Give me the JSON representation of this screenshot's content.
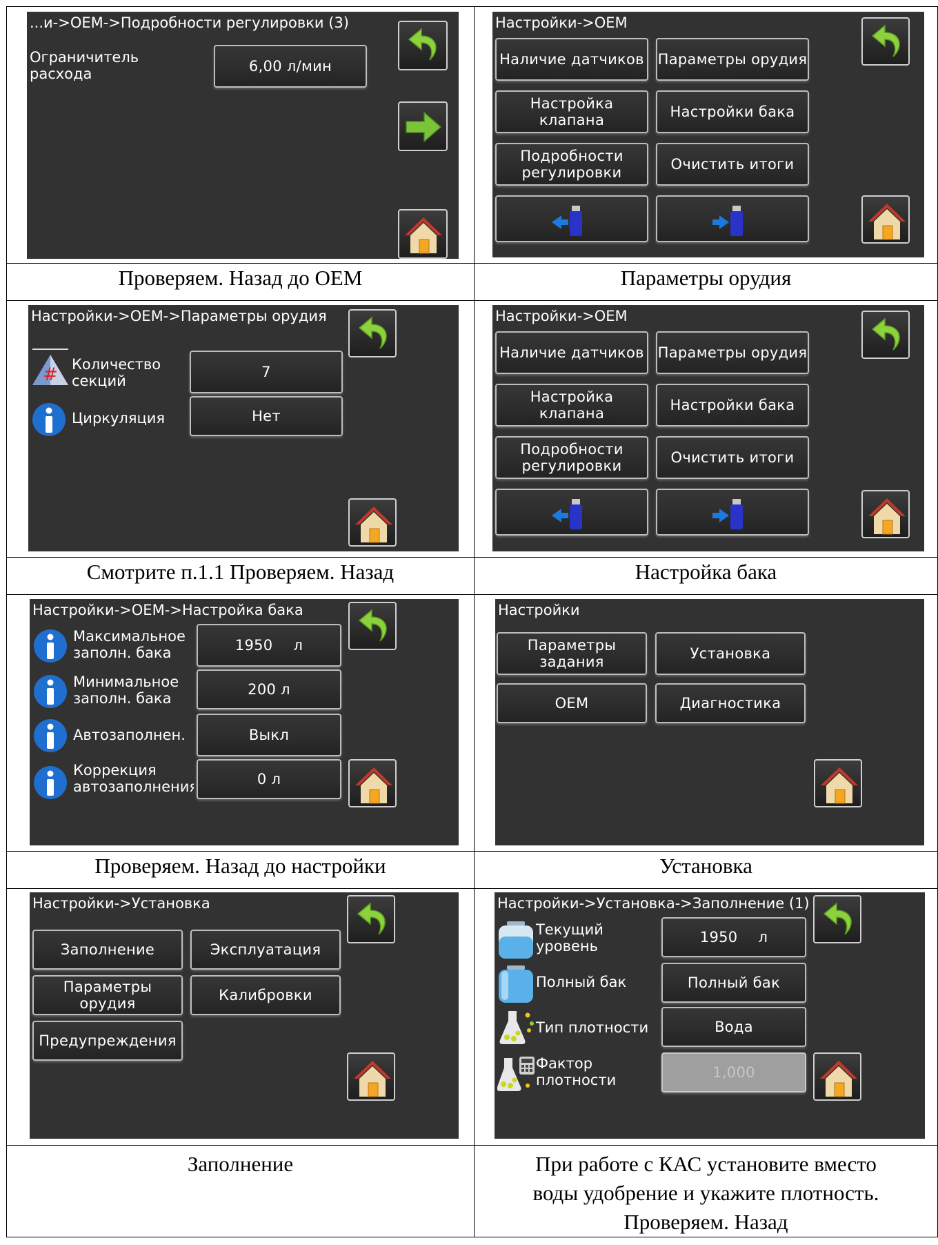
{
  "s1": {
    "title": "...и->OEM->Подробности регулировки (3)",
    "label": "Ограничитель расхода",
    "value": "6,00 л/мин"
  },
  "s2": {
    "title": "Настройки->OEM",
    "buttons": [
      "Наличие датчиков",
      "Параметры орудия",
      "Настройка клапана",
      "Настройки бака",
      "Подробности регулировки",
      "Очистить итоги"
    ]
  },
  "s3": {
    "title": "Настройки->OEM->Параметры орудия",
    "rows": [
      {
        "label": "Количество секций",
        "value": "7"
      },
      {
        "label": "Циркуляция",
        "value": "Нет"
      }
    ]
  },
  "s4": {
    "title": "Настройки->OEM",
    "buttons": [
      "Наличие датчиков",
      "Параметры орудия",
      "Настройка клапана",
      "Настройки бака",
      "Подробности регулировки",
      "Очистить итоги"
    ]
  },
  "s5": {
    "title": "Настройки->OEM->Настройка бака",
    "rows": [
      {
        "label": "Максимальное заполн. бака",
        "value": "1950",
        "unit": "л"
      },
      {
        "label": "Минимальное заполн. бака",
        "value": "200 л"
      },
      {
        "label": "Автозаполнен.",
        "value": "Выкл"
      },
      {
        "label": "Коррекция автозаполнения",
        "value": "0 л"
      }
    ]
  },
  "s6": {
    "title": "Настройки",
    "buttons": [
      "Параметры задания",
      "Установка",
      "OEM",
      "Диагностика"
    ]
  },
  "s7": {
    "title": "Настройки->Установка",
    "buttons": [
      "Заполнение",
      "Эксплуатация",
      "Параметры орудия",
      "Калибровки",
      "Предупреждения"
    ]
  },
  "s8": {
    "title": "Настройки->Установка->Заполнение (1)",
    "rows": [
      {
        "label": "Текущий уровень",
        "value": "1950",
        "unit": "л"
      },
      {
        "label": "Полный бак",
        "value": "Полный бак"
      },
      {
        "label": "Тип плотности",
        "value": "Вода"
      },
      {
        "label": "Фактор плотности",
        "value": "1,000"
      }
    ]
  },
  "captions": [
    "Проверяем. Назад до OEM",
    "Параметры орудия",
    "Смотрите п.1.1 Проверяем. Назад",
    "Настройка бака",
    "Проверяем. Назад до настройки",
    "Установка",
    "Заполнение",
    [
      "При работе с КАС установите вместо",
      "воды удобрение и укажите плотность.",
      "Проверяем. Назад"
    ]
  ],
  "colors": {
    "screen_bg": "#333232",
    "back_arrow": "#8cd23c",
    "next_arrow": "#7bc43a",
    "usb": "#2a33c8",
    "home_roof": "#c0392b",
    "info_icon": "#1f6fd0"
  }
}
